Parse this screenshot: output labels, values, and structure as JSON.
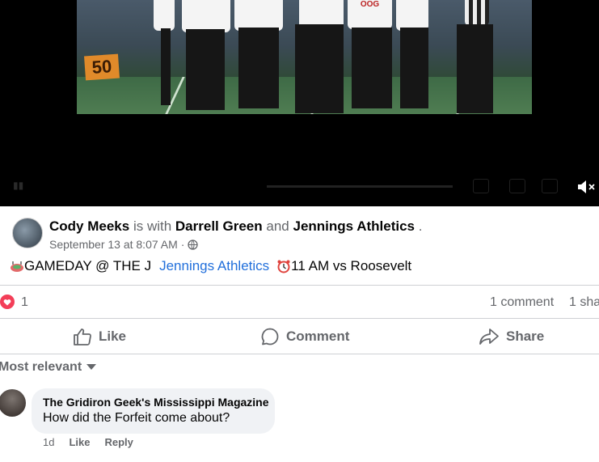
{
  "video": {
    "yard_marker": "50",
    "jersey_number": "OOG"
  },
  "post": {
    "author": "Cody Meeks",
    "with_text": "is with",
    "tagged_1": "Darrell Green",
    "and_text": "and",
    "tagged_2": "Jennings Athletics",
    "period": ".",
    "date": "September 13 at 8:07 AM",
    "dot": "·",
    "audience_icon": "globe-icon",
    "body_prefix": "GAMEDAY @ THE J",
    "body_link": "Jennings Athletics",
    "body_suffix": "11 AM vs Roosevelt",
    "emoji_1": "stadium-emoji",
    "emoji_2": "alarm-clock-emoji"
  },
  "stats": {
    "reaction_icon": "love-reaction-icon",
    "reaction_count": "1",
    "comments": "1 comment",
    "shares": "1 sha"
  },
  "actions": {
    "like": "Like",
    "comment": "Comment",
    "share": "Share"
  },
  "comments": {
    "sort_label": "Most relevant",
    "items": [
      {
        "author": "The Gridiron Geek's Mississippi Magazine",
        "text": "How did the Forfeit come about?",
        "age": "1d",
        "like": "Like",
        "reply": "Reply"
      }
    ]
  },
  "colors": {
    "link": "#216fdb",
    "secondary_text": "#65676b",
    "love": "#f33e58",
    "comment_bubble": "#f0f2f5"
  }
}
